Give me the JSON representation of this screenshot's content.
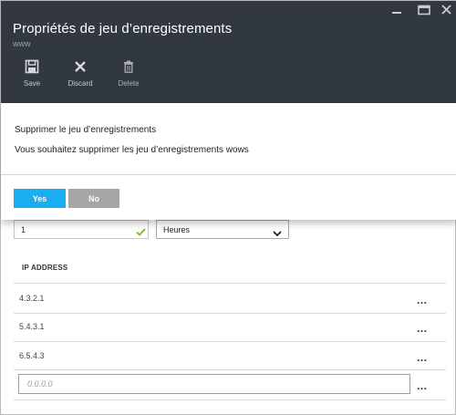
{
  "header": {
    "title": "Propriétés de jeu d’enregistrements",
    "subtitle": "www"
  },
  "window_controls": [
    "minimize-icon",
    "maximize-icon",
    "close-icon"
  ],
  "toolbar": {
    "save_label": "Save",
    "discard_label": "Discard",
    "delete_label": "Delete"
  },
  "dialog": {
    "title": "Supprimer le jeu d’enregistrements",
    "message": "Vous souhaitez supprimer les jeu d’enregistrements wows",
    "yes_label": "Yes",
    "no_label": "No"
  },
  "form": {
    "ttl_value": "1",
    "ttl_unit": "Heures"
  },
  "table": {
    "column_header": "IP ADDRESS",
    "rows": [
      "4.3.2.1",
      "5.4.3.1",
      "6.5.4.3"
    ],
    "row_menu_glyph": "...",
    "new_row_placeholder": "0.0.0.0"
  },
  "colors": {
    "header_bg": "#32383f",
    "yes_button": "#1aaef1",
    "no_button": "#a6a6a6",
    "valid_check": "#7ab929"
  }
}
